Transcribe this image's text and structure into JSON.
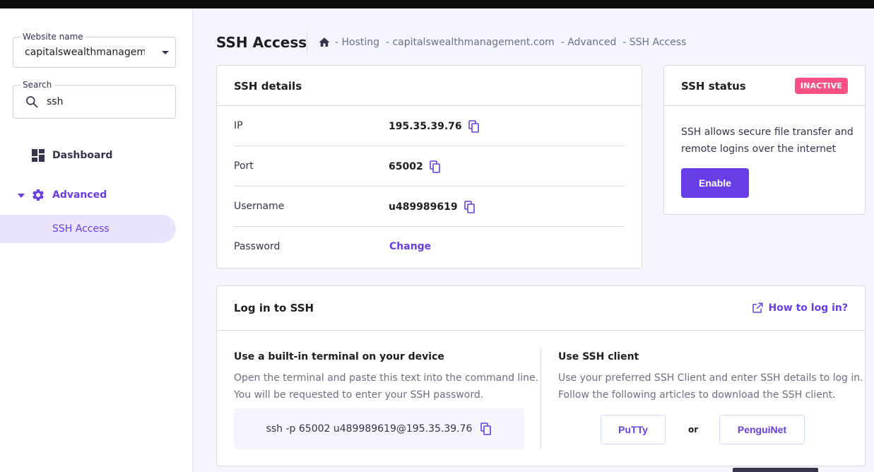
{
  "sidebar": {
    "website_label": "Website name",
    "website_value": "capitalswealthmanagem...",
    "search_label": "Search",
    "search_value": "ssh",
    "nav": {
      "dashboard": "Dashboard",
      "advanced": "Advanced",
      "ssh_access": "SSH Access"
    }
  },
  "header": {
    "title": "SSH Access",
    "breadcrumb": [
      "- Hosting",
      "- capitalswealthmanagement.com",
      "- Advanced",
      "- SSH Access"
    ]
  },
  "ssh_details": {
    "title": "SSH details",
    "rows": [
      {
        "label": "IP",
        "value": "195.35.39.76"
      },
      {
        "label": "Port",
        "value": "65002"
      },
      {
        "label": "Username",
        "value": "u489989619"
      },
      {
        "label": "Password",
        "action": "Change"
      }
    ]
  },
  "ssh_status": {
    "title": "SSH status",
    "badge": "INACTIVE",
    "description": "SSH allows secure file transfer and remote logins over the internet",
    "enable_label": "Enable"
  },
  "login": {
    "title": "Log in to SSH",
    "howto_label": "How to log in?",
    "terminal": {
      "title": "Use a built-in terminal on your device",
      "line1": "Open the terminal and paste this text into the command line.",
      "line2": "You will be requested to enter your SSH password.",
      "command": "ssh -p 65002 u489989619@195.35.39.76"
    },
    "client": {
      "title": "Use SSH client",
      "line1": "Use your preferred SSH Client and enter SSH details to log in.",
      "line2": "Follow the following articles to download the SSH client.",
      "putty_label": "PuTTy",
      "or_label": "or",
      "penguinet_label": "PenguiNet"
    }
  },
  "colors": {
    "accent": "#673de6",
    "badge_inactive": "#fc5185",
    "background": "#f4f5ff",
    "text_dark": "#1d1e20"
  }
}
